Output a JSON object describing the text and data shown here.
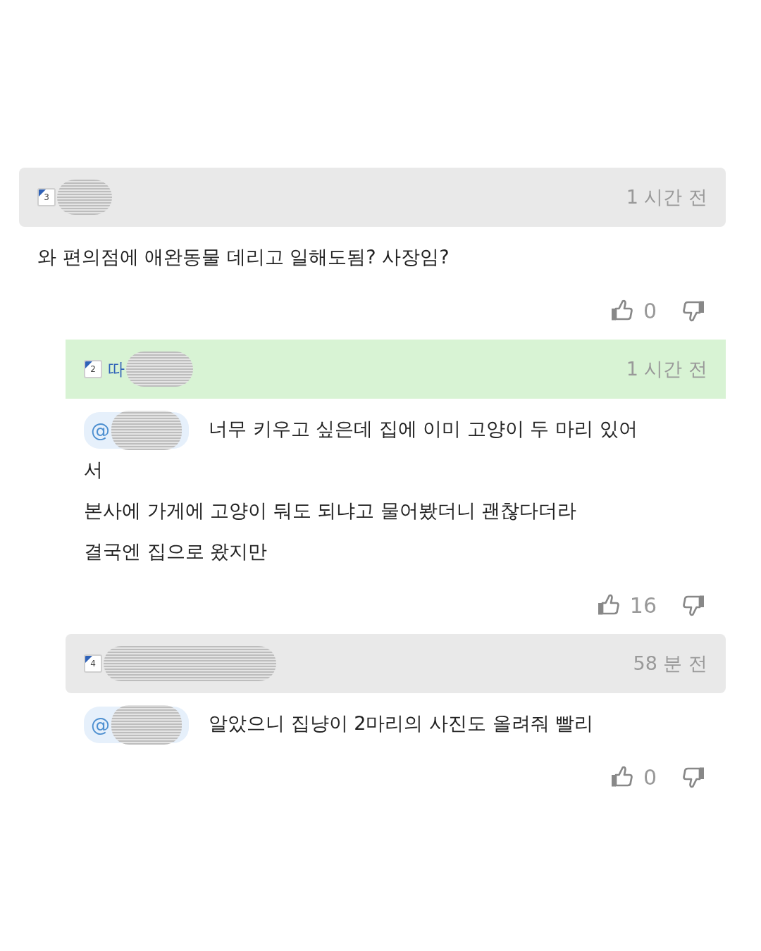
{
  "comments": [
    {
      "level": "3",
      "highlighted": false,
      "time": "1 시간 전",
      "lines": [
        "와 편의점에 애완동물 데리고 일해도됨? 사장임?"
      ],
      "likes": "0",
      "replies": [
        {
          "level": "2",
          "name_fragment": "따",
          "highlighted": true,
          "time": "1 시간 전",
          "mention": "@",
          "lines": [
            "너무 키우고 싶은데 집에 이미 고양이 두 마리 있어",
            "서",
            "본사에 가게에 고양이 둬도 되냐고 물어봤더니 괜찮다더라",
            "결국엔 집으로 왔지만"
          ],
          "likes": "16"
        },
        {
          "level": "4",
          "highlighted": false,
          "time": "58 분 전",
          "mention": "@",
          "lines": [
            "알았으니 집냥이 2마리의 사진도 올려줘 빨리"
          ],
          "likes": "0"
        }
      ]
    }
  ]
}
